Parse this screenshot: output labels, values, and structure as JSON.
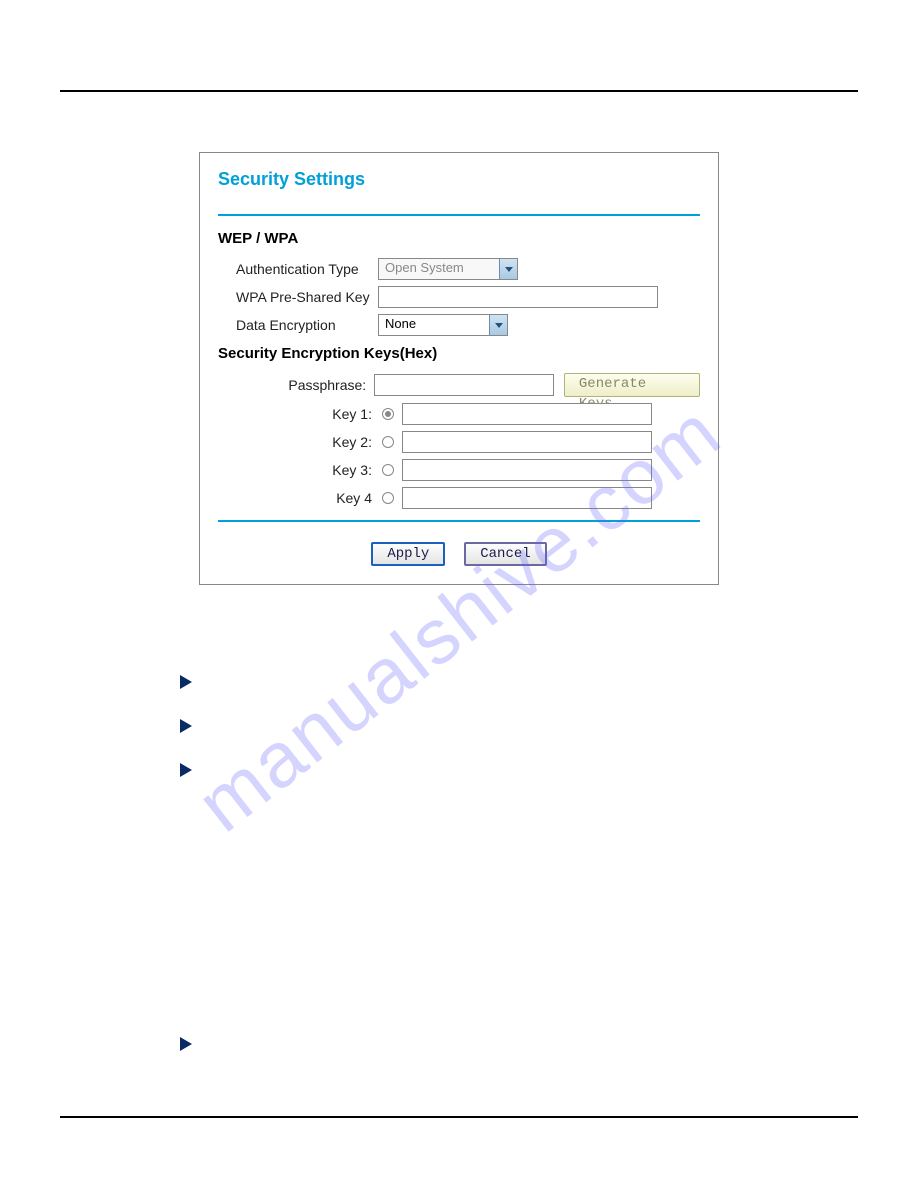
{
  "watermark": "manualshive.com",
  "panel": {
    "title": "Security Settings",
    "section1": "WEP / WPA",
    "auth_label": "Authentication Type",
    "auth_value": "Open System",
    "psk_label": "WPA Pre-Shared Key",
    "psk_value": "",
    "enc_label": "Data Encryption",
    "enc_value": "None",
    "section2": "Security Encryption Keys(Hex)",
    "passphrase_label": "Passphrase:",
    "passphrase_value": "",
    "generate_btn": "Generate Keys",
    "keys": [
      {
        "label": "Key 1:",
        "value": "",
        "checked": true
      },
      {
        "label": "Key 2:",
        "value": "",
        "checked": false
      },
      {
        "label": "Key 3:",
        "value": "",
        "checked": false
      },
      {
        "label": "Key 4",
        "value": "",
        "checked": false
      }
    ],
    "apply_btn": "Apply",
    "cancel_btn": "Cancel"
  }
}
